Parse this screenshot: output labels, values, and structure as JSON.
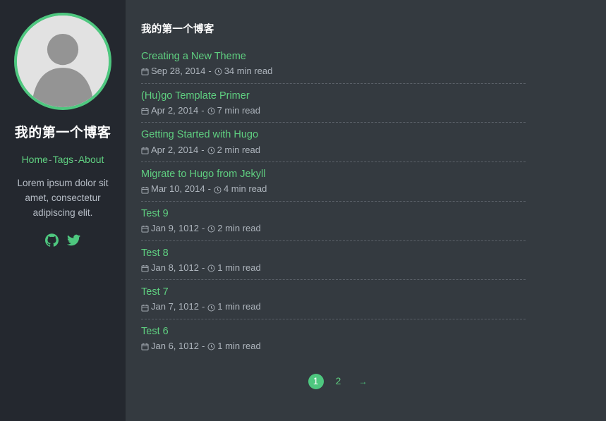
{
  "sidebar": {
    "avatar_icon": "person-avatar-icon",
    "title": "我的第一个博客",
    "nav": [
      {
        "label": "Home"
      },
      {
        "label": "Tags"
      },
      {
        "label": "About"
      }
    ],
    "nav_separator": "-",
    "description": "Lorem ipsum dolor sit amet, consectetur adipiscing elit.",
    "social": [
      {
        "name": "github-icon",
        "label": "GitHub"
      },
      {
        "name": "twitter-icon",
        "label": "Twitter"
      }
    ]
  },
  "main": {
    "page_title": "我的第一个博客",
    "meta_separator": "-",
    "posts": [
      {
        "title": "Creating a New Theme",
        "date": "Sep 28, 2014",
        "read_time": "34 min read"
      },
      {
        "title": "(Hu)go Template Primer",
        "date": "Apr 2, 2014",
        "read_time": "7 min read"
      },
      {
        "title": "Getting Started with Hugo",
        "date": "Apr 2, 2014",
        "read_time": "2 min read"
      },
      {
        "title": "Migrate to Hugo from Jekyll",
        "date": "Mar 10, 2014",
        "read_time": "4 min read"
      },
      {
        "title": "Test 9",
        "date": "Jan 9, 1012",
        "read_time": "2 min read"
      },
      {
        "title": "Test 8",
        "date": "Jan 8, 1012",
        "read_time": "1 min read"
      },
      {
        "title": "Test 7",
        "date": "Jan 7, 1012",
        "read_time": "1 min read"
      },
      {
        "title": "Test 6",
        "date": "Jan 6, 1012",
        "read_time": "1 min read"
      }
    ],
    "pagination": {
      "pages": [
        {
          "label": "1",
          "active": true
        },
        {
          "label": "2",
          "active": false
        }
      ],
      "next_label": "→"
    }
  },
  "colors": {
    "accent_green": "#5fcf80",
    "accent_green_solid": "#4ec77f",
    "sidebar_bg": "#24282f",
    "main_bg": "#343a40",
    "title_white": "#ffffff",
    "meta_gray": "#aeb5bd",
    "separator_gray": "#5b6169"
  }
}
